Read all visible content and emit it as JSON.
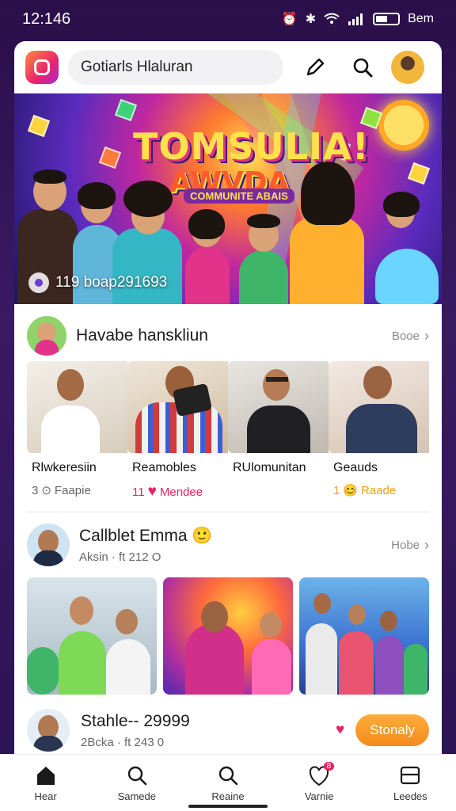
{
  "status_bar": {
    "time": "12:146",
    "carrier": "Bem"
  },
  "header": {
    "search_placeholder": "Gotiarls Hlaluran"
  },
  "hero": {
    "title": "TOMSULIA!",
    "subtitle": "AWVDA",
    "tagline": "COMMUNITE ABAIS",
    "stats": "119 boap291693"
  },
  "section1": {
    "title": "Havabe hanskliun",
    "more_label": "Booe",
    "items": [
      {
        "title": "Rlwkeresiin",
        "count": "3",
        "stat_label": "Faapie",
        "stat_kind": "circle"
      },
      {
        "title": "Reamobles",
        "count": "11",
        "stat_label": "Mendee",
        "stat_kind": "heart"
      },
      {
        "title": "RUlomunitan",
        "count": "",
        "stat_label": "",
        "stat_kind": "none"
      },
      {
        "title": "Geauds",
        "count": "1",
        "stat_label": "Raade",
        "stat_kind": "emoji"
      }
    ]
  },
  "section2": {
    "title": "Callblet Emma",
    "subtitle": "Aksin · ft 212 O",
    "more_label": "Hobe"
  },
  "section3": {
    "title": "Stahle-- 29999",
    "subtitle": "2Bcka · ft 243 0",
    "follow_label": "Stonaly"
  },
  "bottom_nav": {
    "items": [
      {
        "label": "Hear",
        "icon": "home-icon"
      },
      {
        "label": "Samede",
        "icon": "search-icon"
      },
      {
        "label": "Reaine",
        "icon": "search-icon"
      },
      {
        "label": "Varnie",
        "icon": "notification-icon",
        "badge": "8"
      },
      {
        "label": "Leedes",
        "icon": "panel-icon"
      }
    ]
  },
  "colors": {
    "accent": "#f28a1c",
    "heart": "#e8245f",
    "banner_purple": "#5b2bbd"
  }
}
